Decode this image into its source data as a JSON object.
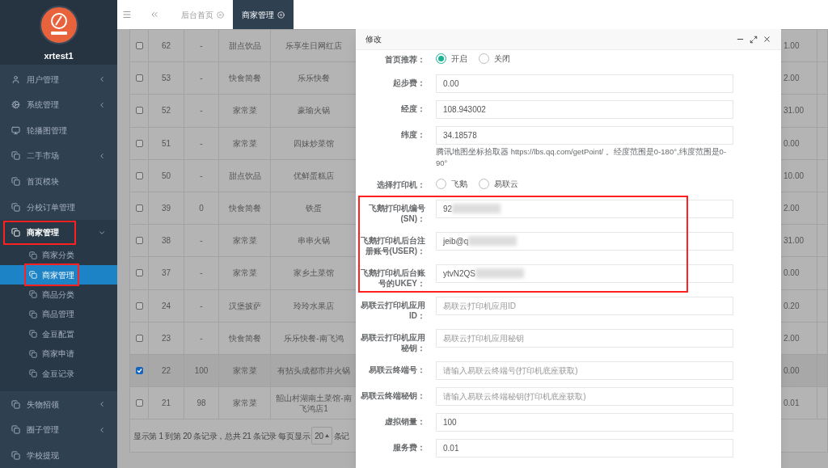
{
  "sidebar": {
    "user": "xrtest1",
    "items": [
      {
        "label": "用户管理",
        "has_submenu": true,
        "expanded": false,
        "highlighted": false
      },
      {
        "label": "系统管理",
        "has_submenu": true,
        "expanded": false,
        "highlighted": false
      },
      {
        "label": "轮播图管理",
        "has_submenu": false,
        "highlighted": false
      },
      {
        "label": "二手市场",
        "has_submenu": true,
        "expanded": false,
        "highlighted": false
      },
      {
        "label": "首页模块",
        "has_submenu": false,
        "highlighted": false
      },
      {
        "label": "分校订单管理",
        "has_submenu": false,
        "highlighted": false
      },
      {
        "label": "商家管理",
        "has_submenu": true,
        "highlighted": true,
        "expanded": true,
        "children": [
          {
            "label": "商家分类",
            "selected": false,
            "highlighted": false
          },
          {
            "label": "商家管理",
            "selected": true,
            "highlighted": true
          },
          {
            "label": "商品分类",
            "selected": false,
            "highlighted": false
          },
          {
            "label": "商品管理",
            "selected": false,
            "highlighted": false
          },
          {
            "label": "金豆配置",
            "selected": false,
            "highlighted": false
          },
          {
            "label": "商家申请",
            "selected": false,
            "highlighted": false
          },
          {
            "label": "金豆记录",
            "selected": false,
            "highlighted": false
          }
        ]
      },
      {
        "label": "失物招领",
        "has_submenu": true,
        "expanded": false,
        "highlighted": false
      },
      {
        "label": "圈子管理",
        "has_submenu": true,
        "expanded": false,
        "highlighted": false
      },
      {
        "label": "学校提现",
        "has_submenu": false,
        "highlighted": false
      }
    ]
  },
  "tabs": [
    {
      "label": "后台首页",
      "selected": false
    },
    {
      "label": "商家管理",
      "selected": true
    }
  ],
  "table": {
    "rows": [
      {
        "checked": false,
        "id": "62",
        "column_2": "-",
        "category": "甜点饮品",
        "name": "乐享生日网红店",
        "column_last": "1.00"
      },
      {
        "checked": false,
        "id": "53",
        "column_2": "-",
        "category": "快食简餐",
        "name": "乐乐快餐",
        "column_last": "2.00"
      },
      {
        "checked": false,
        "id": "52",
        "column_2": "-",
        "category": "家常菜",
        "name": "豪瑜火锅",
        "column_last": "31.00"
      },
      {
        "checked": false,
        "id": "51",
        "column_2": "-",
        "category": "家常菜",
        "name": "四妹炒菜馆",
        "column_last": "0.00"
      },
      {
        "checked": false,
        "id": "50",
        "column_2": "-",
        "category": "甜点饮品",
        "name": "优鲜蛋糕店",
        "column_last": "10.00"
      },
      {
        "checked": false,
        "id": "39",
        "column_2": "0",
        "category": "快食简餐",
        "name": "铁蛋",
        "column_last": "2.00"
      },
      {
        "checked": false,
        "id": "38",
        "column_2": "-",
        "category": "家常菜",
        "name": "串串火锅",
        "column_last": "31.00"
      },
      {
        "checked": false,
        "id": "37",
        "column_2": "-",
        "category": "家常菜",
        "name": "家乡土菜馆",
        "column_last": "0.00"
      },
      {
        "checked": false,
        "id": "24",
        "column_2": "-",
        "category": "汉堡披萨",
        "name": "玲玲水果店",
        "column_last": "0.20"
      },
      {
        "checked": false,
        "id": "23",
        "column_2": "-",
        "category": "快食简餐",
        "name": "乐乐快餐-南飞鸿",
        "column_last": "2.00"
      },
      {
        "checked": true,
        "id": "22",
        "column_2": "100",
        "category": "家常菜",
        "name": "有拈头成都市井火锅",
        "column_last": "0.00"
      },
      {
        "checked": false,
        "id": "21",
        "column_2": "98",
        "category": "家常菜",
        "name": "韶山村湖南土菜馆-南飞鸿店1",
        "column_last": "0.01"
      }
    ],
    "footer": "显示第 1 到第 20 条记录，总共 21 条记录 每页显示",
    "page_size": "20",
    "footer_tail": "条记"
  },
  "dialog": {
    "title": "修改",
    "fields": [
      {
        "kind": "radio",
        "label": "首页推荐：",
        "options": [
          {
            "label": "开启",
            "selected": true
          },
          {
            "label": "关闭",
            "selected": false
          }
        ],
        "highlighted": false
      },
      {
        "kind": "input",
        "label": "起步费：",
        "value": "0.00",
        "highlighted": false
      },
      {
        "kind": "input",
        "label": "经度：",
        "value": "108.943002",
        "highlighted": false
      },
      {
        "kind": "input",
        "label": "纬度：",
        "value": "34.18578",
        "hint": "腾讯地图坐标拾取器 https://lbs.qq.com/getPoint/ 。经度范围是0-180°,纬度范围是0-90°",
        "highlighted": false
      },
      {
        "kind": "radio",
        "label": "选择打印机：",
        "options": [
          {
            "label": "飞鹅",
            "selected": false
          },
          {
            "label": "易联云",
            "selected": false
          }
        ],
        "highlighted": false
      },
      {
        "kind": "input",
        "label": "飞鹅打印机编号(SN)：",
        "value": "92",
        "blurred": true,
        "highlighted": true
      },
      {
        "kind": "input",
        "label": "飞鹅打印机后台注册账号(USER)：",
        "value": "jeib@q",
        "blurred": true,
        "highlighted": true
      },
      {
        "kind": "input",
        "label": "飞鹅打印机后台账号的UKEY：",
        "value": "ytvN2QS",
        "blurred": true,
        "highlighted": true
      },
      {
        "kind": "input",
        "label": "易联云打印机应用ID：",
        "placeholder": "易联云打印机应用ID",
        "highlighted": false
      },
      {
        "kind": "input",
        "label": "易联云打印机应用秘钥：",
        "placeholder": "易联云打印机应用秘钥",
        "highlighted": false
      },
      {
        "kind": "input",
        "label": "易联云终端号：",
        "placeholder": "请输入易联云终端号(打印机底座获取)",
        "highlighted": false
      },
      {
        "kind": "input",
        "label": "易联云终端秘钥：",
        "placeholder": "请输入易联云终端秘钥(打印机底座获取)",
        "highlighted": false
      },
      {
        "kind": "input",
        "label": "虚拟销量：",
        "value": "100",
        "highlighted": false
      },
      {
        "kind": "input",
        "label": "服务费：",
        "value": "0.01",
        "highlighted": false
      }
    ]
  }
}
